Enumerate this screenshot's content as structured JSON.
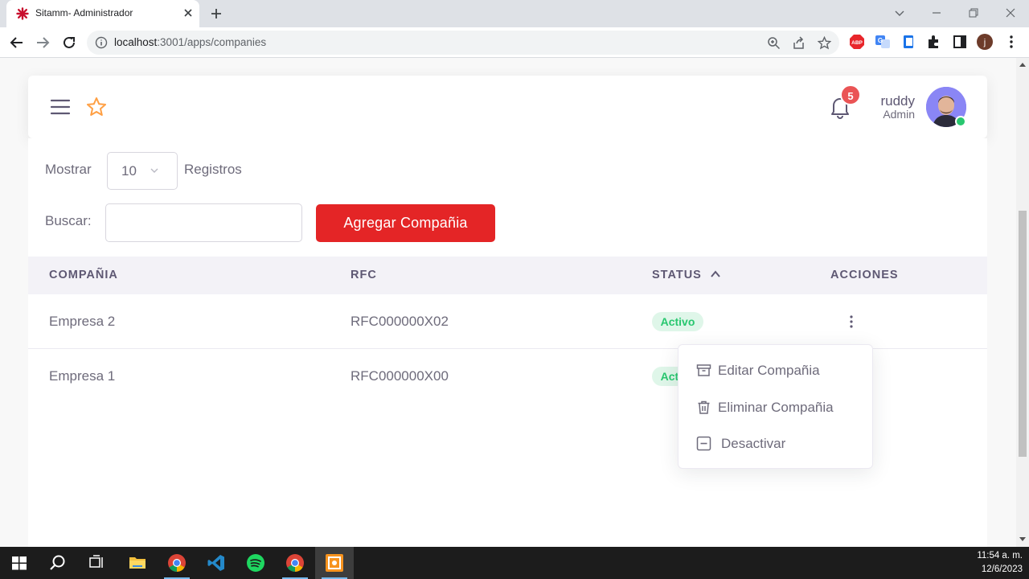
{
  "browser": {
    "tab_title": "Sitamm- Administrador",
    "url_host": "localhost",
    "url_path": ":3001/apps/companies"
  },
  "header": {
    "notification_count": "5",
    "user_name": "ruddy",
    "user_role": "Admin"
  },
  "controls": {
    "show_label": "Mostrar",
    "page_size": "10",
    "records_label": "Registros",
    "search_label": "Buscar:",
    "search_value": "",
    "add_button": "Agregar Compañia"
  },
  "table": {
    "columns": [
      "COMPAÑIA",
      "RFC",
      "STATUS",
      "ACCIONES"
    ],
    "rows": [
      {
        "company": "Empresa 2",
        "rfc": "RFC000000X02",
        "status": "Activo"
      },
      {
        "company": "Empresa 1",
        "rfc": "RFC000000X00",
        "status": "Activo"
      }
    ]
  },
  "action_menu": {
    "items": [
      "Editar Compañia",
      "Eliminar Compañia",
      "Desactivar"
    ]
  },
  "taskbar": {
    "time": "11:54 a. m.",
    "date": "12/6/2023"
  },
  "colors": {
    "brand_red": "#e42526",
    "success": "#28c76f",
    "badge": "#ea5455"
  }
}
